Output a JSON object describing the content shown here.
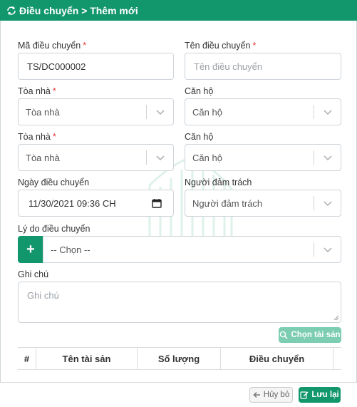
{
  "header": {
    "title": "Điều chuyển > Thêm mới",
    "icon": "sync-icon"
  },
  "colors": {
    "accent": "#12966b",
    "required": "#e53935",
    "accent_light": "#7ccdb1"
  },
  "form": {
    "code": {
      "label": "Mã điều chuyển",
      "required_mark": "*",
      "value": "TS/DC000002"
    },
    "name": {
      "label": "Tên điều chuyển",
      "required_mark": "*",
      "placeholder": "Tên điều chuyển"
    },
    "building_from": {
      "label": "Tòa nhà",
      "required_mark": "*",
      "selected": "Tòa nhà"
    },
    "apartment_from": {
      "label": "Căn hộ",
      "selected": "Căn hộ"
    },
    "building_to": {
      "label": "Tòa nhà",
      "required_mark": "*",
      "selected": "Tòa nhà"
    },
    "apartment_to": {
      "label": "Căn hộ",
      "selected": "Căn hộ"
    },
    "date": {
      "label": "Ngày điều chuyển",
      "value": "11/30/2021 09:36 CH"
    },
    "person": {
      "label": "Người đảm trách",
      "selected": "Người đảm trách"
    },
    "reason": {
      "label": "Lý do điều chuyển",
      "add_label": "+",
      "selected": "-- Chọn --"
    },
    "note": {
      "label": "Ghi chú",
      "placeholder": "Ghi chú"
    }
  },
  "choose_assets_button": "Chọn tài sản",
  "table": {
    "columns": [
      "#",
      "Tên tài sản",
      "Số lượng",
      "Điều chuyển",
      ""
    ]
  },
  "footer": {
    "cancel_label": "Hủy bỏ",
    "save_label": "Lưu lại"
  }
}
